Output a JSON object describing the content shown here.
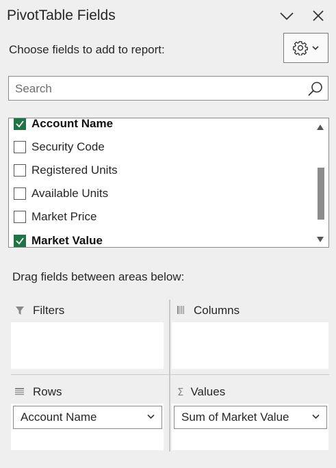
{
  "panel": {
    "title": "PivotTable Fields",
    "collapse_icon": "chevron-down-icon",
    "close_icon": "close-icon"
  },
  "choose_label": "Choose fields to add to report:",
  "tools_button": {
    "icon": "gear-icon",
    "caret_icon": "chevron-down-icon"
  },
  "search": {
    "placeholder": "Search",
    "value": "",
    "icon": "search-icon"
  },
  "fields": [
    {
      "label": "Account Name",
      "checked": true
    },
    {
      "label": "Security Code",
      "checked": false
    },
    {
      "label": "Registered Units",
      "checked": false
    },
    {
      "label": "Available Units",
      "checked": false
    },
    {
      "label": "Market Price",
      "checked": false
    },
    {
      "label": "Market Value",
      "checked": true
    }
  ],
  "drag_label": "Drag fields between areas below:",
  "areas": {
    "filters": {
      "title": "Filters",
      "icon": "filter-icon"
    },
    "columns": {
      "title": "Columns",
      "icon": "columns-icon"
    },
    "rows": {
      "title": "Rows",
      "icon": "rows-icon",
      "items": [
        "Account Name"
      ]
    },
    "values": {
      "title": "Values",
      "icon": "sigma-icon",
      "items": [
        "Sum of Market Value"
      ]
    }
  },
  "colors": {
    "check_green": "#217346",
    "panel_bg": "#efefef"
  }
}
